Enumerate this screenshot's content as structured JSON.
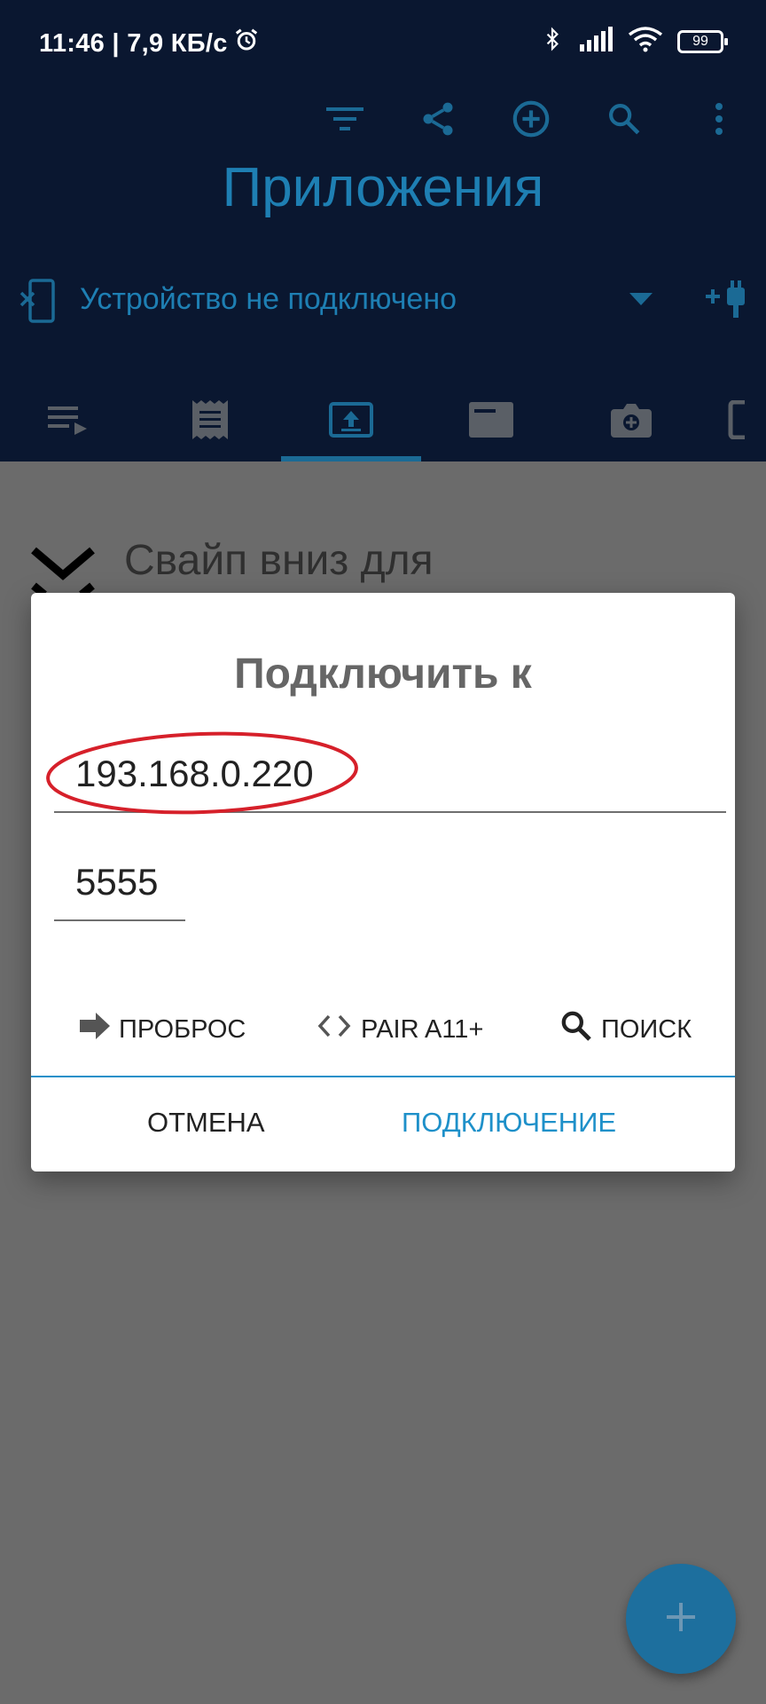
{
  "status_bar": {
    "time_speed": "11:46 | 7,9 КБ/с",
    "battery": "99"
  },
  "app": {
    "title": "Приложения",
    "device_status": "Устройство не подключено",
    "accent_color": "#1e7fb3",
    "header_bg": "#0a1730",
    "toolbar_icons": [
      "filter-icon",
      "share-icon",
      "add-circle-icon",
      "search-icon",
      "more-vert-icon"
    ],
    "tabs": [
      "playlist-icon",
      "receipt-icon",
      "upload-icon",
      "card-icon",
      "camera-icon",
      "device-icon"
    ],
    "selected_tab_index": 2
  },
  "background_content": {
    "swipe_hint": "Свайп вниз для"
  },
  "dialog": {
    "title": "Подключить к",
    "ip_value": "193.168.0.220",
    "port_value": "5555",
    "actions": [
      {
        "icon": "arrow-right-icon",
        "label": "ПРОБРОС"
      },
      {
        "icon": "code-brackets-icon",
        "label": "PAIR A11+"
      },
      {
        "icon": "search-icon",
        "label": "ПОИСК"
      }
    ],
    "cancel_label": "ОТМЕНА",
    "connect_label": "ПОДКЛЮЧЕНИЕ",
    "accent_color": "#1e90c9",
    "highlight_color": "#d6202a"
  },
  "fab": {
    "icon": "plus-icon"
  }
}
